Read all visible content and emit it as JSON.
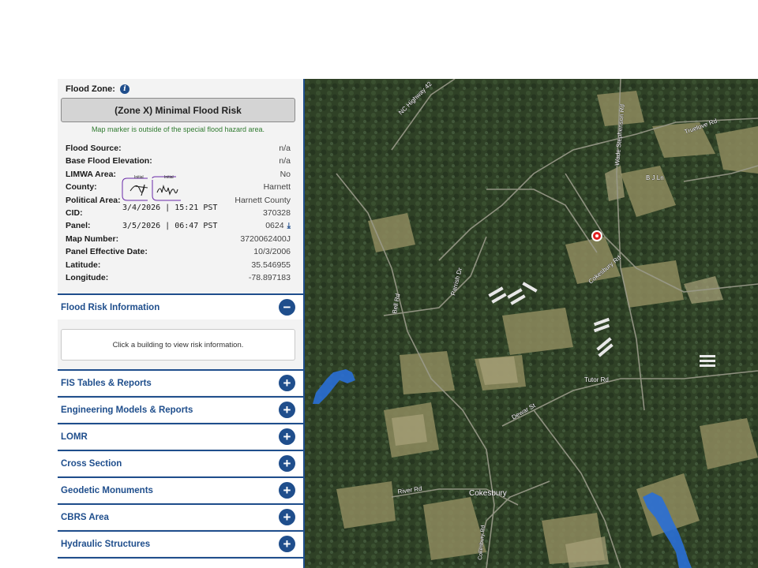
{
  "flood_zone": {
    "header_label": "Flood Zone:",
    "info_icon": "i",
    "zone_button_label": "(Zone X) Minimal Flood Risk",
    "note": "Map marker is outside of the special flood hazard area."
  },
  "properties": [
    {
      "label": "Flood Source:",
      "value": "n/a"
    },
    {
      "label": "Base Flood Elevation:",
      "value": "n/a"
    },
    {
      "label": "LIMWA Area:",
      "value": "No"
    },
    {
      "label": "County:",
      "value": "Harnett"
    },
    {
      "label": "Political Area:",
      "value": "Harnett County"
    },
    {
      "label": "CID:",
      "value": "370328"
    },
    {
      "label": "Panel:",
      "value": "0624"
    },
    {
      "label": "Map Number:",
      "value": "3720062400J"
    },
    {
      "label": "Panel Effective Date:",
      "value": "10/3/2006"
    },
    {
      "label": "Latitude:",
      "value": "35.546955"
    },
    {
      "label": "Longitude:",
      "value": "-78.897183"
    }
  ],
  "panel_download_icon": "download-icon",
  "signature_overlay": {
    "initial_label_1": "Initial",
    "initial_label_2": "Initial",
    "date_line_1": "3/4/2026 | 15:21 PST",
    "date_line_2": "3/5/2026 | 06:47 PST"
  },
  "flood_risk": {
    "title": "Flood Risk Information",
    "toggle": "−",
    "message": "Click a building to view risk information."
  },
  "sections": [
    {
      "title": "FIS Tables & Reports",
      "toggle": "+"
    },
    {
      "title": "Engineering Models & Reports",
      "toggle": "+"
    },
    {
      "title": "LOMR",
      "toggle": "+"
    },
    {
      "title": "Cross Section",
      "toggle": "+"
    },
    {
      "title": "Geodetic Monuments",
      "toggle": "+"
    },
    {
      "title": "CBRS Area",
      "toggle": "+"
    },
    {
      "title": "Hydraulic Structures",
      "toggle": "+"
    }
  ],
  "map": {
    "labels": {
      "nc_highway": "NC Highway 42",
      "wade_stephenson": "Wade Stephenson Rd",
      "truelove": "Truelove Rd",
      "bj_ln": "B J Ln",
      "cokesbury_rd": "Cokesbury Rd",
      "parrish_dr": "Parrish Dr",
      "bell_rd": "Bell Rd",
      "tutor_rd": "Tutor Rd",
      "dewar_st": "Dewar St",
      "river_rd": "River Rd",
      "cokesbury_town": "Cokesbury",
      "cokesbury_rd_south": "Cokesbury Rd"
    },
    "colors": {
      "marker": "#e02020",
      "flood_area": "#2a6fd6",
      "accent": "#1f4e8c"
    }
  }
}
